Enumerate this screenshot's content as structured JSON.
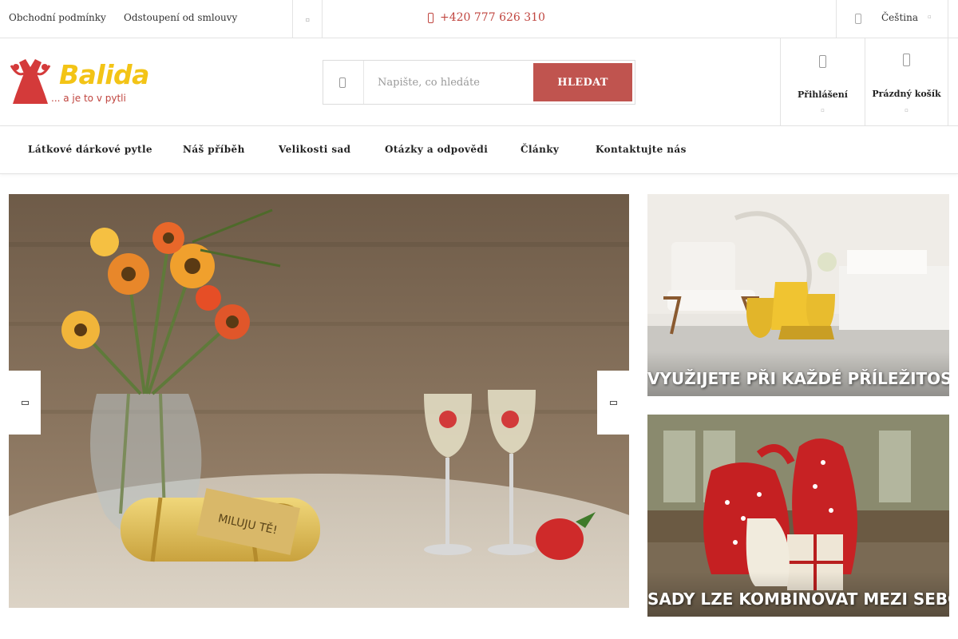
{
  "topbar": {
    "links": [
      "Obchodní podmínky",
      "Odstoupení od smlouvy"
    ],
    "more_icon": "more-dots-icon",
    "phone": "+420 777 626 310",
    "phone_icon": "phone-icon",
    "language": "Čeština",
    "language_icon": "globe-icon"
  },
  "header": {
    "logo": {
      "name": "Balida",
      "tagline": "... a je to v pytli"
    },
    "search": {
      "placeholder": "Napište, co hledáte",
      "button": "HLEDAT",
      "icon": "search-icon"
    },
    "login_label": "Přihlášení",
    "cart_label": "Prázdný košík"
  },
  "nav": {
    "items": [
      "Látkové dárkové pytle",
      "Náš příběh",
      "Velikosti sad",
      "Otázky a odpovědi",
      "Články",
      "Kontaktujte nás"
    ]
  },
  "hero": {
    "tag_text": "MILUJU TĚ!"
  },
  "banners": [
    {
      "title": "VYUŽIJETE PŘI KAŽDÉ PŘÍLEŽITOSTI"
    },
    {
      "title": "SADY LZE KOMBINOVAT MEZI SEBOU"
    }
  ],
  "colors": {
    "accent": "#c0544f",
    "brand_yellow": "#f3c416",
    "brand_red": "#c0453f"
  }
}
